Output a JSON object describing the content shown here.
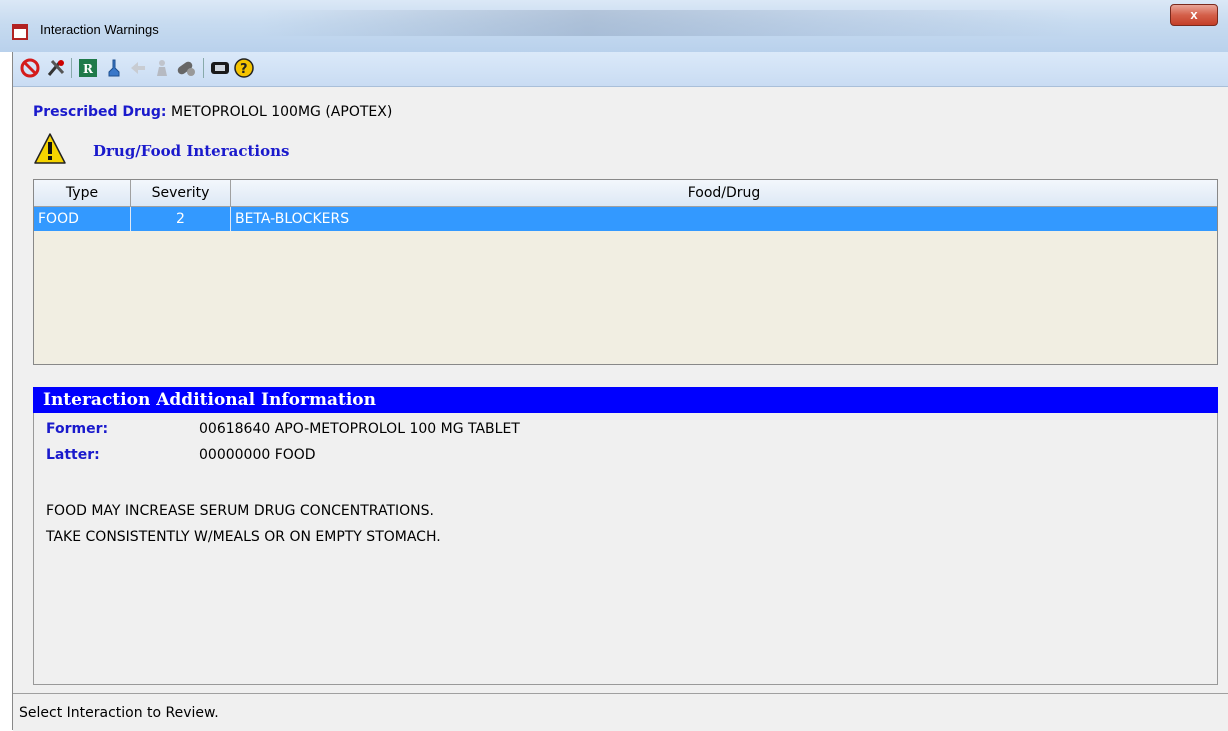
{
  "window": {
    "title": "Interaction Warnings",
    "close_glyph": "x"
  },
  "toolbar": {
    "icons": [
      "stop-icon",
      "tools-icon",
      "rx-icon",
      "dropper-icon",
      "back-disabled-icon",
      "person-disabled-icon",
      "pills-icon",
      "screen-icon",
      "help-icon"
    ]
  },
  "prescribed": {
    "label": "Prescribed Drug:",
    "value": "METOPROLOL 100MG (APOTEX)"
  },
  "section": {
    "title": "Drug/Food Interactions"
  },
  "grid": {
    "columns": [
      "Type",
      "Severity",
      "Food/Drug"
    ],
    "rows": [
      {
        "type": "FOOD",
        "severity": "2",
        "food_drug": "BETA-BLOCKERS"
      }
    ]
  },
  "info": {
    "title": "Interaction Additional Information",
    "former_label": "Former:",
    "former_value": "00618640 APO-METOPROLOL 100 MG TABLET",
    "latter_label": "Latter:",
    "latter_value": "00000000 FOOD",
    "line1": "FOOD MAY INCREASE SERUM DRUG CONCENTRATIONS.",
    "line2": "TAKE CONSISTENTLY W/MEALS OR ON EMPTY STOMACH."
  },
  "status": {
    "text": "Select Interaction to Review."
  },
  "colors": {
    "accent_blue": "#1a1acc",
    "header_blue": "#0000ff",
    "selection": "#3399ff",
    "grid_bg": "#f1eee2"
  }
}
